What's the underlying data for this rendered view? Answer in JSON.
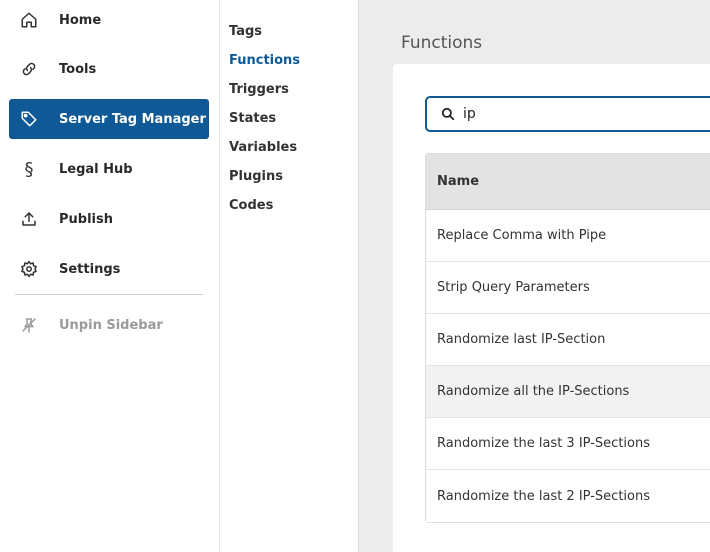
{
  "sidebar": {
    "items": [
      {
        "label": "Home",
        "icon": "home-icon"
      },
      {
        "label": "Tools",
        "icon": "link-icon"
      },
      {
        "label": "Server Tag Manager",
        "icon": "tag-icon",
        "active": true
      },
      {
        "label": "Legal Hub",
        "icon": "section-icon"
      },
      {
        "label": "Publish",
        "icon": "upload-icon"
      },
      {
        "label": "Settings",
        "icon": "gear-icon"
      }
    ],
    "unpin_label": "Unpin Sidebar"
  },
  "subnav": {
    "items": [
      "Tags",
      "Functions",
      "Triggers",
      "States",
      "Variables",
      "Plugins",
      "Codes"
    ],
    "active": "Functions"
  },
  "main": {
    "title": "Functions",
    "search": {
      "value": "ip",
      "placeholder": ""
    },
    "table": {
      "header": "Name",
      "rows": [
        "Replace Comma with Pipe",
        "Strip Query Parameters",
        "Randomize last IP-Section",
        "Randomize all the IP-Sections",
        "Randomize the last 3 IP-Sections",
        "Randomize the last 2 IP-Sections"
      ]
    }
  },
  "colors": {
    "accent": "#0f5a96",
    "muted": "#9a9a9a"
  }
}
